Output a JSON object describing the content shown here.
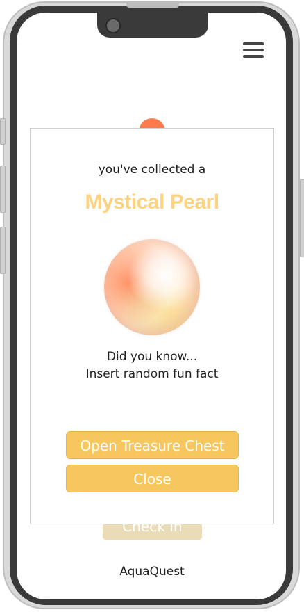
{
  "app": {
    "name": "AquaQuest"
  },
  "background": {
    "checkin_label": "Check In"
  },
  "modal": {
    "subtitle": "you've collected a",
    "title": "Mystical Pearl",
    "title_color": "#ffd27f",
    "image_icon": "pearl-icon",
    "fact_heading": "Did you know...",
    "fact_text": "Insert random fun fact",
    "buttons": {
      "open_treasure": "Open Treasure Chest",
      "close": "Close"
    },
    "button_color": "#f6c75f"
  },
  "header": {
    "menu_icon": "hamburger-menu-icon"
  }
}
